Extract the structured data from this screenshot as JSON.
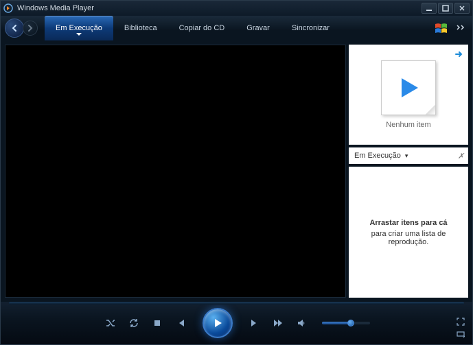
{
  "window": {
    "title": "Windows Media Player"
  },
  "tabs": {
    "now_playing": "Em Execução",
    "library": "Biblioteca",
    "rip": "Copiar do CD",
    "burn": "Gravar",
    "sync": "Sincronizar"
  },
  "side": {
    "no_item": "Nenhum item",
    "playlist_dd": "Em Execução",
    "drop_bold": "Arrastar itens para cá",
    "drop_line": "para criar uma lista de reprodução."
  },
  "colors": {
    "accent": "#1a6ac8",
    "bg_dark": "#0a1520"
  }
}
